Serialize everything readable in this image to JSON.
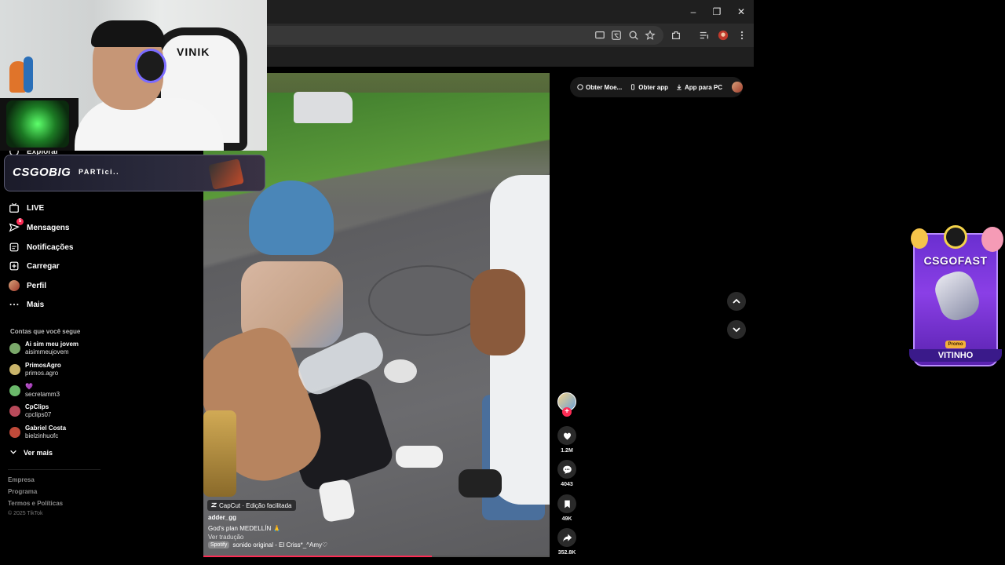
{
  "browser": {
    "window_controls": {
      "minimize": "–",
      "restore": "❐",
      "close": "✕"
    }
  },
  "webcam": {
    "chair_brand": "VINIK"
  },
  "sponsor_banner": {
    "logo": "CSGOBIG",
    "text": "PARTici.."
  },
  "sidebar": {
    "explore_label": "Explorar",
    "items": [
      {
        "label": "LIVE",
        "icon": "live-icon"
      },
      {
        "label": "Mensagens",
        "icon": "messages-icon",
        "badge": "5"
      },
      {
        "label": "Notificações",
        "icon": "notifications-icon"
      },
      {
        "label": "Carregar",
        "icon": "upload-icon"
      },
      {
        "label": "Perfil",
        "icon": "profile-avatar"
      },
      {
        "label": "Mais",
        "icon": "more-icon"
      }
    ],
    "following_title": "Contas que você segue",
    "following": [
      {
        "name": "Ai sim meu jovem",
        "handle": "aisimmeujovem",
        "color": "#7aa86a"
      },
      {
        "name": "PrimosAgro",
        "handle": "primos.agro",
        "color": "#c9b46a"
      },
      {
        "name": "💜",
        "handle": "secretamm3",
        "color": "#6ab86a"
      },
      {
        "name": "CpClips",
        "handle": "cpclips07",
        "color": "#b84a5a"
      },
      {
        "name": "Gabriel Costa",
        "handle": "bielzinhuofc",
        "color": "#c04a3a"
      }
    ],
    "see_more": "Ver mais",
    "footer": [
      "Empresa",
      "Programa",
      "Termos e Políticas"
    ],
    "copyright": "© 2025 TikTok"
  },
  "video": {
    "capcut_tag": "CapCut · Edição facilitada",
    "author": "adder_gg",
    "description": "God's plan MEDELLÍN 🙏",
    "translate": "Ver tradução",
    "music_tag": "Spotify",
    "music": "sonido original - El Criss*_^Amy♡",
    "progress": 0.66
  },
  "actions": {
    "likes": "1.2M",
    "comments": "4043",
    "saves": "49K",
    "shares": "352.8K"
  },
  "topbar": {
    "coins": "Obter Moe...",
    "app": "Obter app",
    "pc_app": "App para PC"
  },
  "promo": {
    "title": "CSGOFAST",
    "chip": "Promo",
    "name": "VITINHO"
  }
}
